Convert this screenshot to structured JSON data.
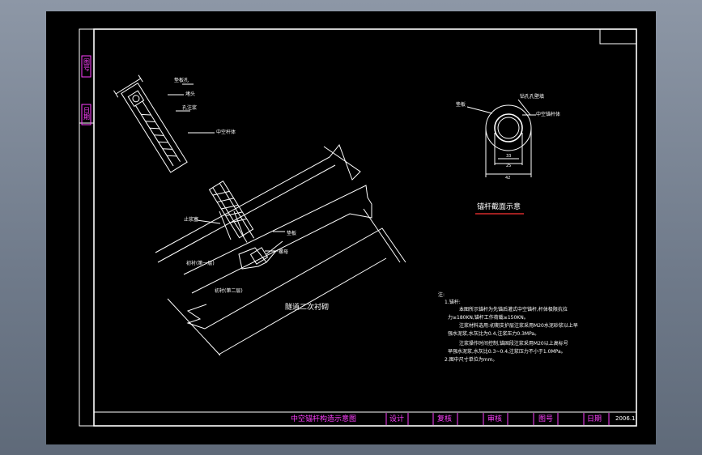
{
  "side_labels": [
    "图号",
    "日期"
  ],
  "title_block": {
    "title": "中空锚杆构造示意图",
    "design": "设计",
    "review": "复核",
    "audit": "审核",
    "drawing_no": "图号",
    "date_label": "日期",
    "date_value": "2006.1"
  },
  "bolt_labels": {
    "top_plate": "垫板孔",
    "plug": "堵头",
    "grout_tube": "孔注浆",
    "hollow_bar": "中空杆体",
    "stop_ring": "止浆塞",
    "plate": "垫板",
    "nut": "螺母",
    "layer1": "初衬(第一层)",
    "layer2": "初衬(第二层)",
    "secondary": "隧道二次衬砌"
  },
  "section": {
    "title": "锚杆截面示意",
    "label_plate": "垫板",
    "label_hole": "钻孔孔壁填",
    "label_bar": "中空锚杆体",
    "dim_inner": "33",
    "dim_mid": "25",
    "dim_outer": "42"
  },
  "notes": {
    "heading": "注:",
    "lines": [
      "1.锚杆:",
      "本图所示锚杆为先锚后灌式中空锚杆,杆体极限抗拉",
      "力≥180KN,锚杆工作荷载≥150KN。",
      "注浆材料选用:初期支护层注浆采用M20水泥砂浆以上早",
      "强水泥浆,水灰比为0.4,注浆压力0.3MPa。",
      "注浆操作时间控制,锚固段注浆采用M20以上高标号",
      "早强水泥浆,水灰比0.3~0.4,注浆压力不小于1.0MPa。",
      "2.图中尺寸单位为mm。"
    ]
  }
}
